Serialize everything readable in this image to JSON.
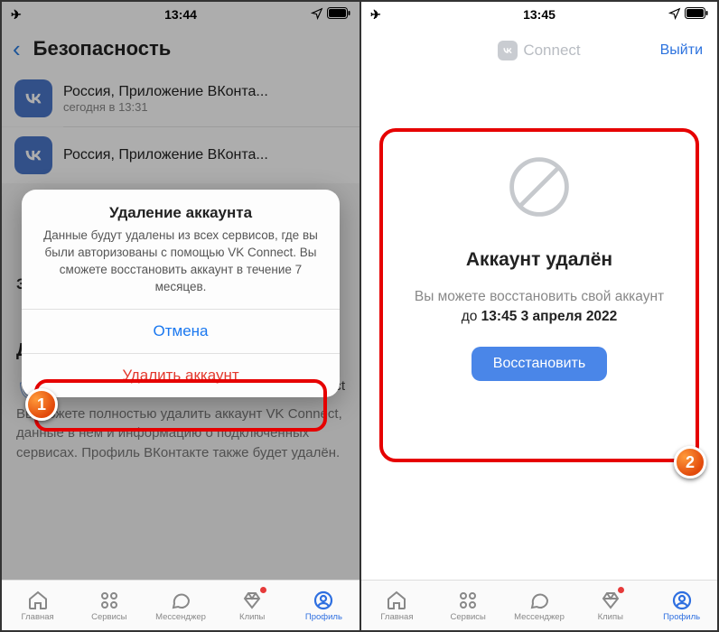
{
  "screenA": {
    "status": {
      "time": "13:44"
    },
    "header": {
      "title": "Безопасность"
    },
    "sessions": [
      {
        "title": "Россия, Приложение ВКонта...",
        "sub": "сегодня в 13:31"
      },
      {
        "title": "Россия, Приложение ВКонта...",
        "sub": ""
      }
    ],
    "bg_section_d": "Д",
    "bg_paragraph_top": "За",
    "bg_paragraph_bottom": "Вы можете полностью удалить аккаунт VK Connect, данные в нём и информацию о подключённых сервисах. Профиль ВКонтакте также будет удалён.",
    "bg_small": "ct",
    "sheet": {
      "title": "Удаление аккаунта",
      "body": "Данные будут удалены из всех сервисов, где вы были авторизованы с помощью VK Connect. Вы сможете восстановить аккаунт в течение 7 месяцев.",
      "cancel": "Отмена",
      "delete": "Удалить аккаунт"
    },
    "marker": "1"
  },
  "screenB": {
    "status": {
      "time": "13:45"
    },
    "connect": {
      "brand": "Connect",
      "logout": "Выйти"
    },
    "card": {
      "title": "Аккаунт удалён",
      "sub": "Вы можете восстановить свой аккаунт",
      "date_prefix": "до ",
      "date_strong": "13:45 3 апреля 2022",
      "restore": "Восстановить"
    },
    "marker": "2"
  },
  "tabs": {
    "home": "Главная",
    "services": "Сервисы",
    "messenger": "Мессенджер",
    "clips": "Клипы",
    "profile": "Профиль"
  }
}
